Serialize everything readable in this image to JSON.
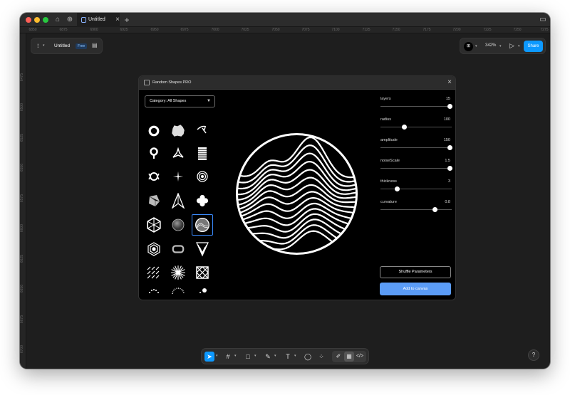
{
  "titlebar": {
    "tab_title": "Untitled",
    "new_tab": "+"
  },
  "ruler": {
    "top": [
      "6850",
      "6875",
      "6900",
      "6925",
      "6950",
      "6975",
      "7000",
      "7025",
      "7050",
      "7075",
      "7100",
      "7125",
      "7150",
      "7175",
      "7200",
      "7225",
      "7250",
      "7275"
    ],
    "left": [
      "6475",
      "6500",
      "6525",
      "6550",
      "6575",
      "6600",
      "6625",
      "6650",
      "6675",
      "6700"
    ]
  },
  "file": {
    "name": "Untitled",
    "badge": "Free"
  },
  "topright": {
    "zoom": "342%",
    "share": "Share"
  },
  "plugin": {
    "title": "Random Shapes PRO",
    "category": "Category: All Shapes",
    "params": [
      {
        "label": "layers",
        "value": "15",
        "level": 0.97
      },
      {
        "label": "radius",
        "value": "100",
        "level": 0.33
      },
      {
        "label": "amplitude",
        "value": "150",
        "level": 0.97
      },
      {
        "label": "noiseScale",
        "value": "1.5",
        "level": 0.97
      },
      {
        "label": "thickness",
        "value": "3",
        "level": 0.23
      },
      {
        "label": "curvature",
        "value": "0.8",
        "level": 0.76
      }
    ],
    "shuffle": "Shuffle Parameters",
    "add": "Add to canvas"
  },
  "icons": {
    "shapes": [
      "ring",
      "blob",
      "brush",
      "keyhole",
      "triskele",
      "ladder",
      "swirl-open",
      "sparkle",
      "spiral",
      "crumpled",
      "arrowhead",
      "plus-rounded",
      "hexagon-net",
      "sphere",
      "wave-sphere",
      "hexagon-stack",
      "rounded-rect",
      "fan",
      "diagonal-lines",
      "starburst",
      "lattice",
      "dot-arc",
      "dot-half-sun",
      "dot-ball"
    ],
    "toolbar": [
      "move-icon",
      "frame-icon",
      "rectangle-icon",
      "pen-icon",
      "text-icon",
      "comment-icon",
      "components-icon",
      "dev-mode-icon"
    ]
  },
  "help": "?"
}
